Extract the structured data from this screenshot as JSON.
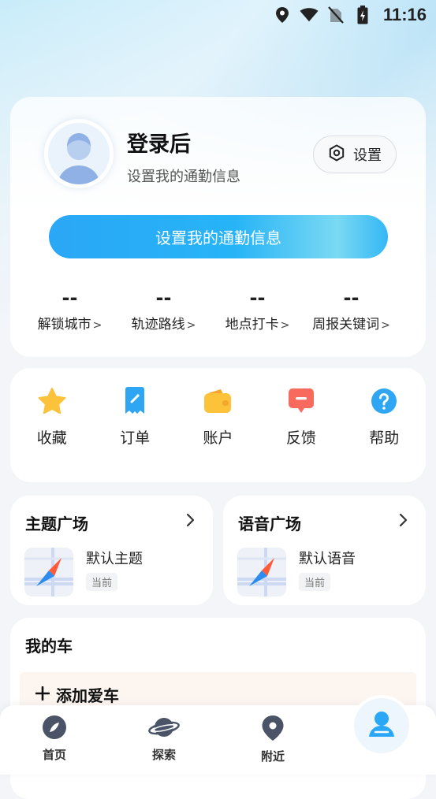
{
  "status_bar": {
    "time": "11:16",
    "icons": [
      "location-icon",
      "wifi-icon",
      "no-sim-icon",
      "battery-charging-icon"
    ]
  },
  "profile": {
    "title": "登录后",
    "subtitle": "设置我的通勤信息",
    "settings_label": "设置",
    "commute_button": "设置我的通勤信息",
    "stats": [
      {
        "value": "--",
        "label": "解锁城市"
      },
      {
        "value": "--",
        "label": "轨迹路线"
      },
      {
        "value": "--",
        "label": "地点打卡"
      },
      {
        "value": "--",
        "label": "周报关键词"
      }
    ]
  },
  "actions": [
    {
      "label": "收藏",
      "icon": "star-icon",
      "color": "#fdc23c"
    },
    {
      "label": "订单",
      "icon": "order-icon",
      "color": "#2fa6f3"
    },
    {
      "label": "账户",
      "icon": "wallet-icon",
      "color": "#fcc23a"
    },
    {
      "label": "反馈",
      "icon": "feedback-icon",
      "color": "#f86a5e"
    },
    {
      "label": "帮助",
      "icon": "help-icon",
      "color": "#2fa6f3"
    }
  ],
  "theme_plaza": {
    "title": "主题广场",
    "item_name": "默认主题",
    "badge": "当前"
  },
  "voice_plaza": {
    "title": "语音广场",
    "item_name": "默认语音",
    "badge": "当前"
  },
  "my_car": {
    "title": "我的车",
    "add_label": "添加爱车"
  },
  "bottom_nav": [
    {
      "label": "首页",
      "icon": "compass-icon"
    },
    {
      "label": "探索",
      "icon": "planet-icon"
    },
    {
      "label": "附近",
      "icon": "location-pin-icon"
    },
    {
      "label": "",
      "icon": "user-icon"
    }
  ],
  "colors": {
    "accent": "#2aa7f6",
    "background": "#f3f5f9"
  }
}
